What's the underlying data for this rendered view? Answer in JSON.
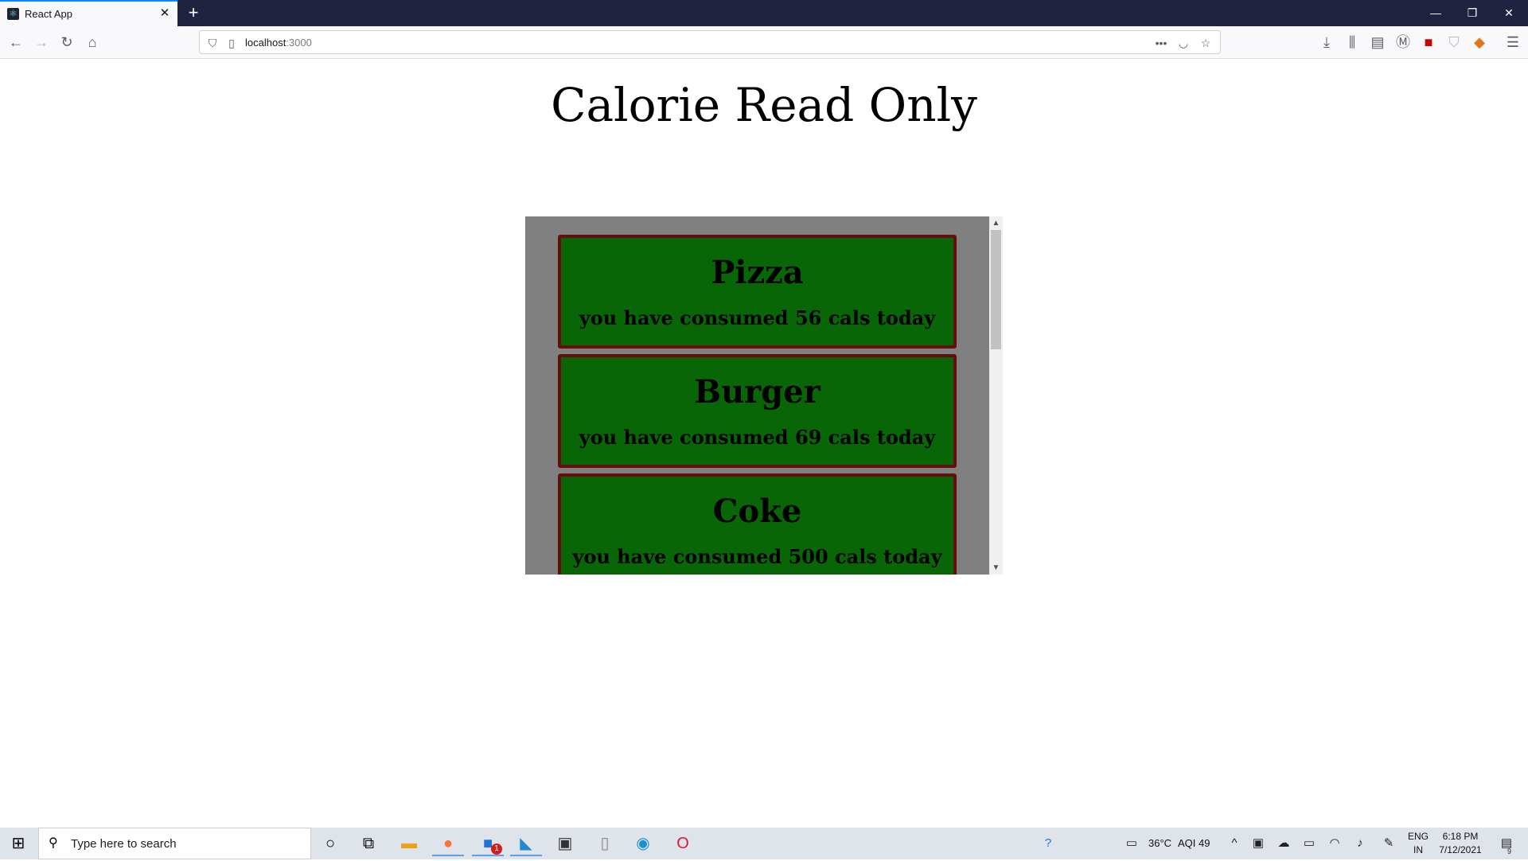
{
  "browser": {
    "tab_title": "React App",
    "url_host": "localhost",
    "url_port": ":3000"
  },
  "page": {
    "title": "Calorie Read Only",
    "items": [
      {
        "name": "Pizza",
        "text": "you have consumed 56 cals today"
      },
      {
        "name": "Burger",
        "text": "you have consumed 69 cals today"
      },
      {
        "name": "Coke",
        "text": "you have consumed 500 cals today"
      }
    ]
  },
  "taskbar": {
    "search_placeholder": "Type here to search",
    "weather_temp": "36°C",
    "aqi": "AQI 49",
    "lang_line1": "ENG",
    "lang_line2": "IN",
    "time": "6:18 PM",
    "date": "7/12/2021",
    "notification_count": "9",
    "store_badge": "1"
  },
  "colors": {
    "card_bg": "#096606",
    "card_border": "#660d0d",
    "list_bg": "#808080",
    "tabbar_bg": "#1f2340"
  }
}
